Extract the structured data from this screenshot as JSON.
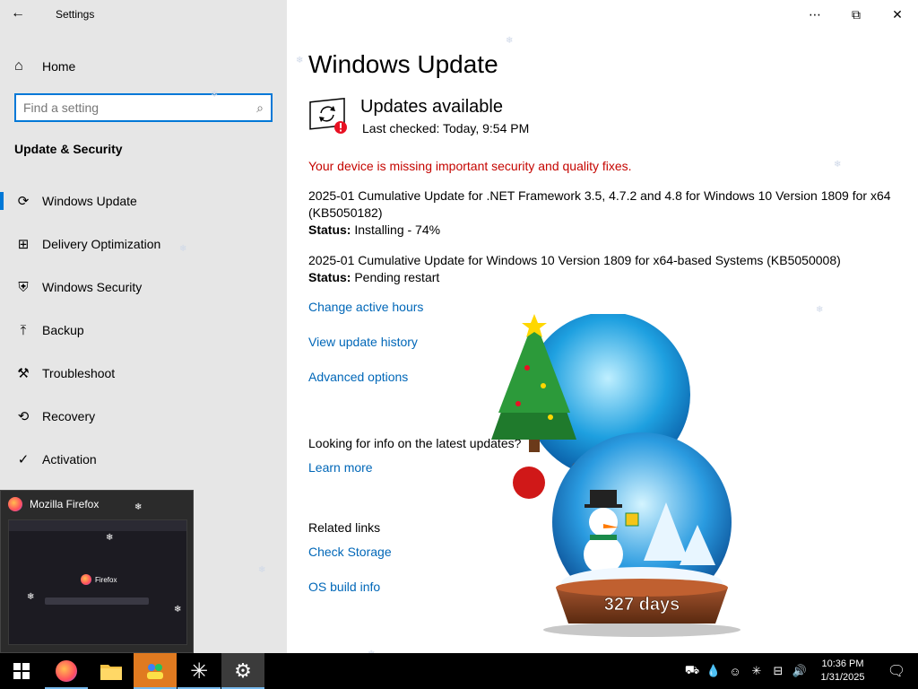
{
  "window": {
    "app_title": "Settings",
    "controls": {
      "minimize": "⋯",
      "maximize": "⧉",
      "close": "✕"
    }
  },
  "sidebar": {
    "home_label": "Home",
    "search_placeholder": "Find a setting",
    "section_title": "Update & Security",
    "items": [
      {
        "label": "Windows Update",
        "icon": "sync-icon",
        "glyph": "⟳"
      },
      {
        "label": "Delivery Optimization",
        "icon": "delivery-optimization-icon",
        "glyph": "⊞"
      },
      {
        "label": "Windows Security",
        "icon": "shield-icon",
        "glyph": "⛨"
      },
      {
        "label": "Backup",
        "icon": "backup-icon",
        "glyph": "⤒"
      },
      {
        "label": "Troubleshoot",
        "icon": "wrench-icon",
        "glyph": "⚒"
      },
      {
        "label": "Recovery",
        "icon": "recovery-icon",
        "glyph": "⟲"
      },
      {
        "label": "Activation",
        "icon": "activation-icon",
        "glyph": "✓"
      }
    ]
  },
  "main": {
    "title": "Windows Update",
    "status_title": "Updates available",
    "last_checked": "Last checked: Today, 9:54 PM",
    "warning": "Your device is missing important security and quality fixes.",
    "updates": [
      {
        "name": "2025-01 Cumulative Update for .NET Framework 3.5, 4.7.2 and 4.8 for Windows 10 Version 1809 for x64 (KB5050182)",
        "status_label": "Status:",
        "status_value": "Installing - 74%",
        "progress_percent": 74
      },
      {
        "name": "2025-01 Cumulative Update for Windows 10 Version 1809 for x64-based Systems (KB5050008)",
        "status_label": "Status:",
        "status_value": "Pending restart"
      }
    ],
    "links": {
      "change_active_hours": "Change active hours",
      "view_update_history": "View update history",
      "advanced_options": "Advanced options"
    },
    "info_text": "Looking for info on the latest updates?",
    "learn_more": "Learn more",
    "related_title": "Related links",
    "check_storage": "Check Storage",
    "os_build_info": "OS build info"
  },
  "decoration": {
    "globe_counter": "327 days"
  },
  "firefox_preview": {
    "title": "Mozilla Firefox",
    "logo_text": "Firefox"
  },
  "taskbar": {
    "time": "10:36 PM",
    "date": "1/31/2025"
  },
  "colors": {
    "accent": "#0078d7",
    "link": "#0067b8",
    "warning": "#c50500",
    "sidebar_bg": "#e6e6e6",
    "taskbar_bg": "#000000"
  }
}
